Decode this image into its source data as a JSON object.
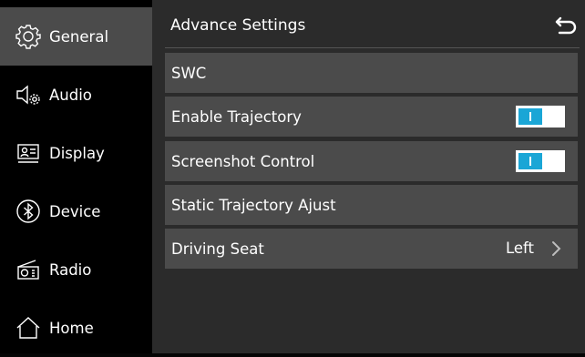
{
  "sidebar": {
    "items": [
      {
        "label": "General",
        "icon": "gear-icon",
        "active": true
      },
      {
        "label": "Audio",
        "icon": "speaker-settings-icon",
        "active": false
      },
      {
        "label": "Display",
        "icon": "display-icon",
        "active": false
      },
      {
        "label": "Device",
        "icon": "bluetooth-icon",
        "active": false
      },
      {
        "label": "Radio",
        "icon": "radio-icon",
        "active": false
      },
      {
        "label": "Home",
        "icon": "home-icon",
        "active": false
      }
    ]
  },
  "header": {
    "title": "Advance Settings",
    "back_icon": "back-arrow-icon"
  },
  "settings": {
    "swc": {
      "label": "SWC"
    },
    "enable_trajectory": {
      "label": "Enable Trajectory",
      "enabled": true
    },
    "screenshot_control": {
      "label": "Screenshot Control",
      "enabled": true
    },
    "static_trajectory": {
      "label": "Static Trajectory Ajust"
    },
    "driving_seat": {
      "label": "Driving Seat",
      "value": "Left"
    }
  },
  "colors": {
    "sidebar_bg": "#000000",
    "active_bg": "#4b4b4b",
    "main_bg": "#2b2b2b",
    "row_bg": "#4b4b4b",
    "toggle_on": "#1aa6d6"
  }
}
